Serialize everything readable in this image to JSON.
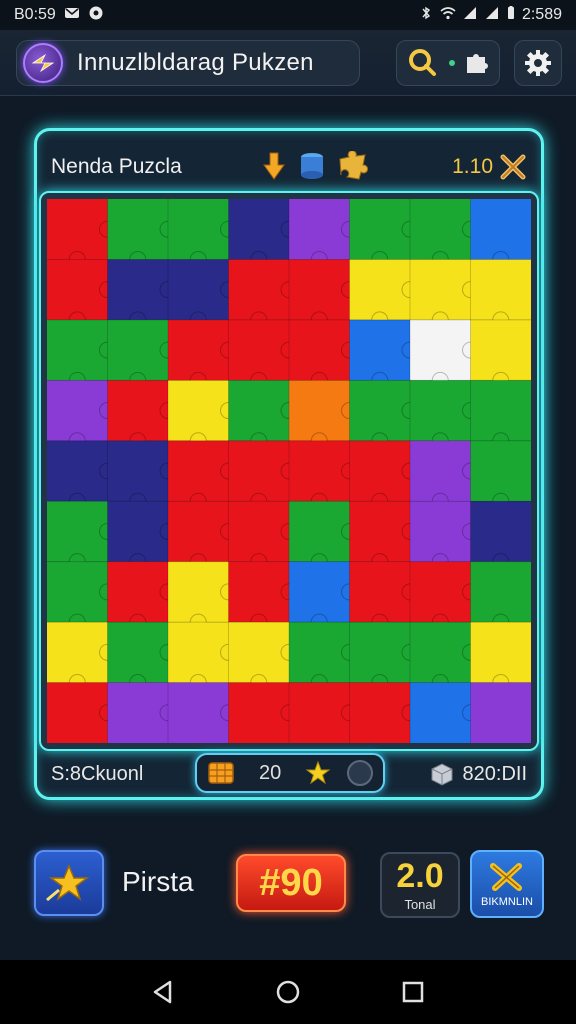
{
  "status_bar": {
    "time_left": "B0:59",
    "time_right": "2:589"
  },
  "header": {
    "title": "Innuzlbldarag Pukzen"
  },
  "board": {
    "name": "Nenda Puzcla",
    "score": "1.10",
    "status_left": "S:8Ckuonl",
    "center_count": "20",
    "status_right": "820:DII"
  },
  "bottom": {
    "player_name": "Pirsta",
    "score_value": "#90",
    "total_value": "2.0",
    "total_label": "Tonal",
    "shuffle_label": "BIKMNLIN"
  },
  "colors": {
    "accent": "#5ff3f0",
    "piece_red": "#e8141c",
    "piece_green": "#1aa832",
    "piece_blue": "#1f72e8",
    "piece_yellow": "#f5e21a",
    "piece_purple": "#8a3bd6",
    "piece_navy": "#2a2a8a",
    "piece_white": "#f4f4f4",
    "piece_orange": "#f57a12"
  },
  "puzzle": {
    "cols": 8,
    "rows": 9,
    "pieces": [
      [
        "red",
        "green",
        "green",
        "navy",
        "purple",
        "green",
        "green",
        "blue"
      ],
      [
        "red",
        "navy",
        "navy",
        "red",
        "red",
        "yellow",
        "yellow",
        "yellow"
      ],
      [
        "green",
        "green",
        "red",
        "red",
        "red",
        "blue",
        "white",
        "yellow"
      ],
      [
        "purple",
        "red",
        "yellow",
        "green",
        "orange",
        "green",
        "green",
        "green"
      ],
      [
        "navy",
        "navy",
        "red",
        "red",
        "red",
        "red",
        "purple",
        "green"
      ],
      [
        "green",
        "navy",
        "red",
        "red",
        "green",
        "red",
        "purple",
        "navy"
      ],
      [
        "green",
        "red",
        "yellow",
        "red",
        "blue",
        "red",
        "red",
        "green"
      ],
      [
        "yellow",
        "green",
        "yellow",
        "yellow",
        "green",
        "green",
        "green",
        "yellow"
      ],
      [
        "red",
        "purple",
        "purple",
        "red",
        "red",
        "red",
        "blue",
        "purple"
      ]
    ]
  }
}
